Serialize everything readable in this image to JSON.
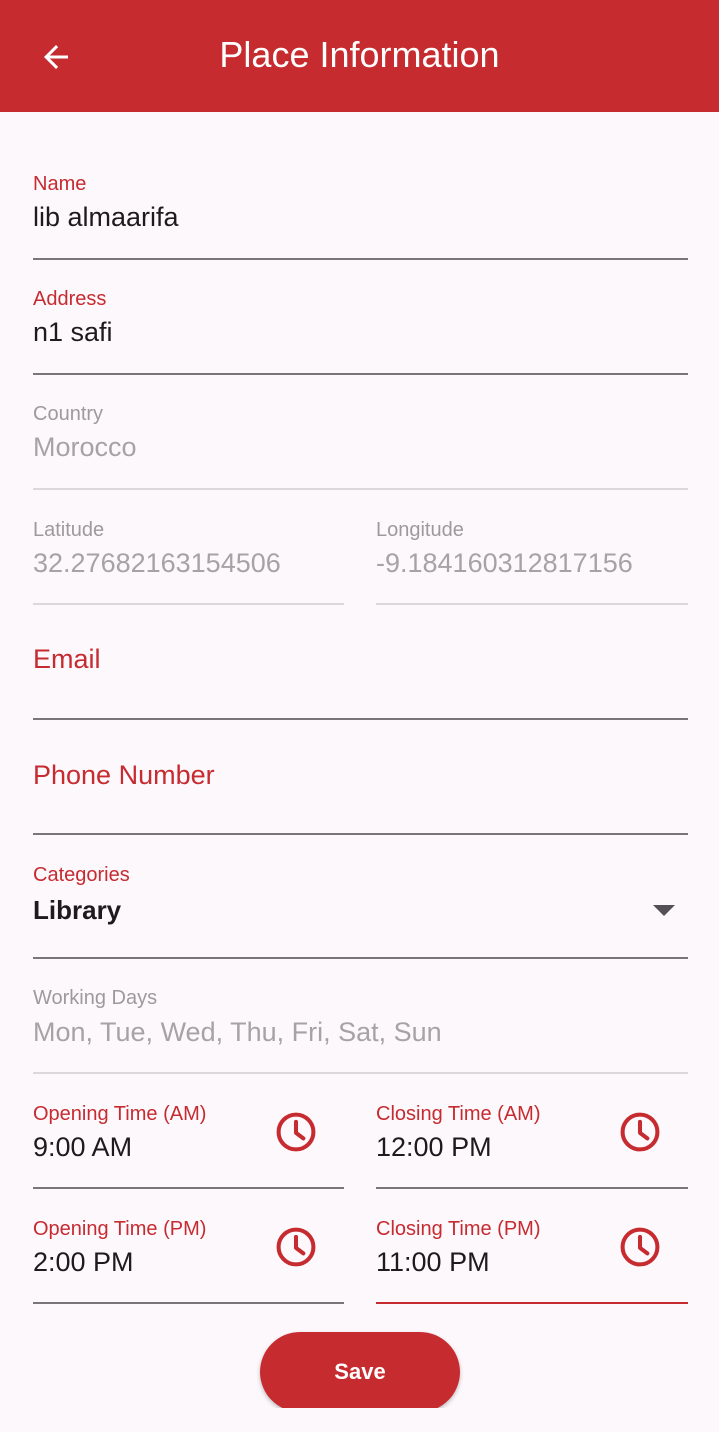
{
  "appbar": {
    "title": "Place Information",
    "back_icon": "arrow-back-icon"
  },
  "form": {
    "name": {
      "label": "Name",
      "value": "lib almaarifa"
    },
    "address": {
      "label": "Address",
      "value": "n1 safi"
    },
    "country": {
      "label": "Country",
      "value": "Morocco"
    },
    "latitude": {
      "label": "Latitude",
      "value": "32.27682163154506"
    },
    "longitude": {
      "label": "Longitude",
      "value": "-9.184160312817156"
    },
    "email": {
      "label": "Email",
      "value": ""
    },
    "phone": {
      "label": "Phone Number",
      "value": ""
    },
    "categories": {
      "label": "Categories",
      "value": "Library",
      "icon": "dropdown-arrow-icon"
    },
    "working_days": {
      "label": "Working Days",
      "value": "Mon, Tue, Wed, Thu, Fri, Sat, Sun"
    },
    "opening_am": {
      "label": "Opening Time (AM)",
      "value": "9:00 AM",
      "icon": "clock-icon"
    },
    "closing_am": {
      "label": "Closing Time (AM)",
      "value": "12:00 PM",
      "icon": "clock-icon"
    },
    "opening_pm": {
      "label": "Opening Time (PM)",
      "value": "2:00 PM",
      "icon": "clock-icon"
    },
    "closing_pm": {
      "label": "Closing Time (PM)",
      "value": "11:00 PM",
      "icon": "clock-icon"
    }
  },
  "save_button": {
    "label": "Save"
  },
  "colors": {
    "primary": "#c62b30",
    "background": "#fdf8fc",
    "text": "#1d1b1e",
    "disabled_text": "#a7a3a5",
    "underline": "#7b7478"
  }
}
